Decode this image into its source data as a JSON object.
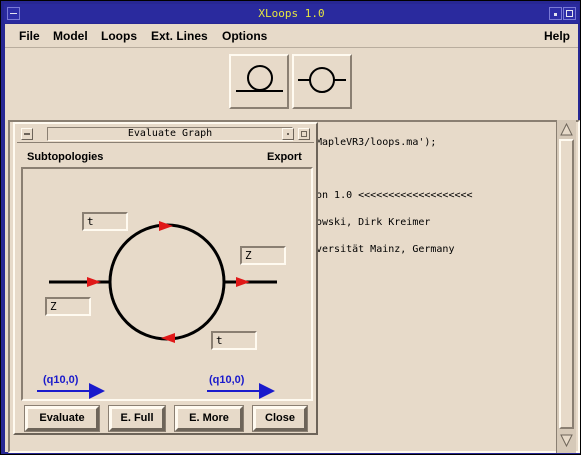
{
  "window": {
    "title": "XLoops 1.0"
  },
  "menubar": {
    "items": [
      "File",
      "Model",
      "Loops",
      "Ext. Lines",
      "Options"
    ],
    "help": "Help"
  },
  "toolbar": {
    "buttons": [
      "tadpole-topology",
      "two-point-topology"
    ]
  },
  "output": {
    "lines": [
      "MapleVR3/loops.ma');",
      "on 1.0 <<<<<<<<<<<<<<<<<<<",
      "owski, Dirk Kreimer",
      "versität Mainz, Germany"
    ]
  },
  "dialog": {
    "title": "Evaluate Graph",
    "menu_left": "Subtopologies",
    "menu_right": "Export",
    "masses": {
      "top": "t",
      "right": "Z",
      "left": "Z",
      "bottom": "t"
    },
    "momenta": {
      "left": "(q10,0)",
      "right": "(q10,0)"
    },
    "buttons": {
      "evaluate": "Evaluate",
      "e_full": "E. Full",
      "e_more": "E. More",
      "close": "Close"
    }
  },
  "colors": {
    "title_bg": "#2a2a9e",
    "title_fg": "#e6e640",
    "panel_bg": "#e7dac9",
    "arrow_red": "#e01818",
    "arrow_blue": "#1a1acc"
  }
}
